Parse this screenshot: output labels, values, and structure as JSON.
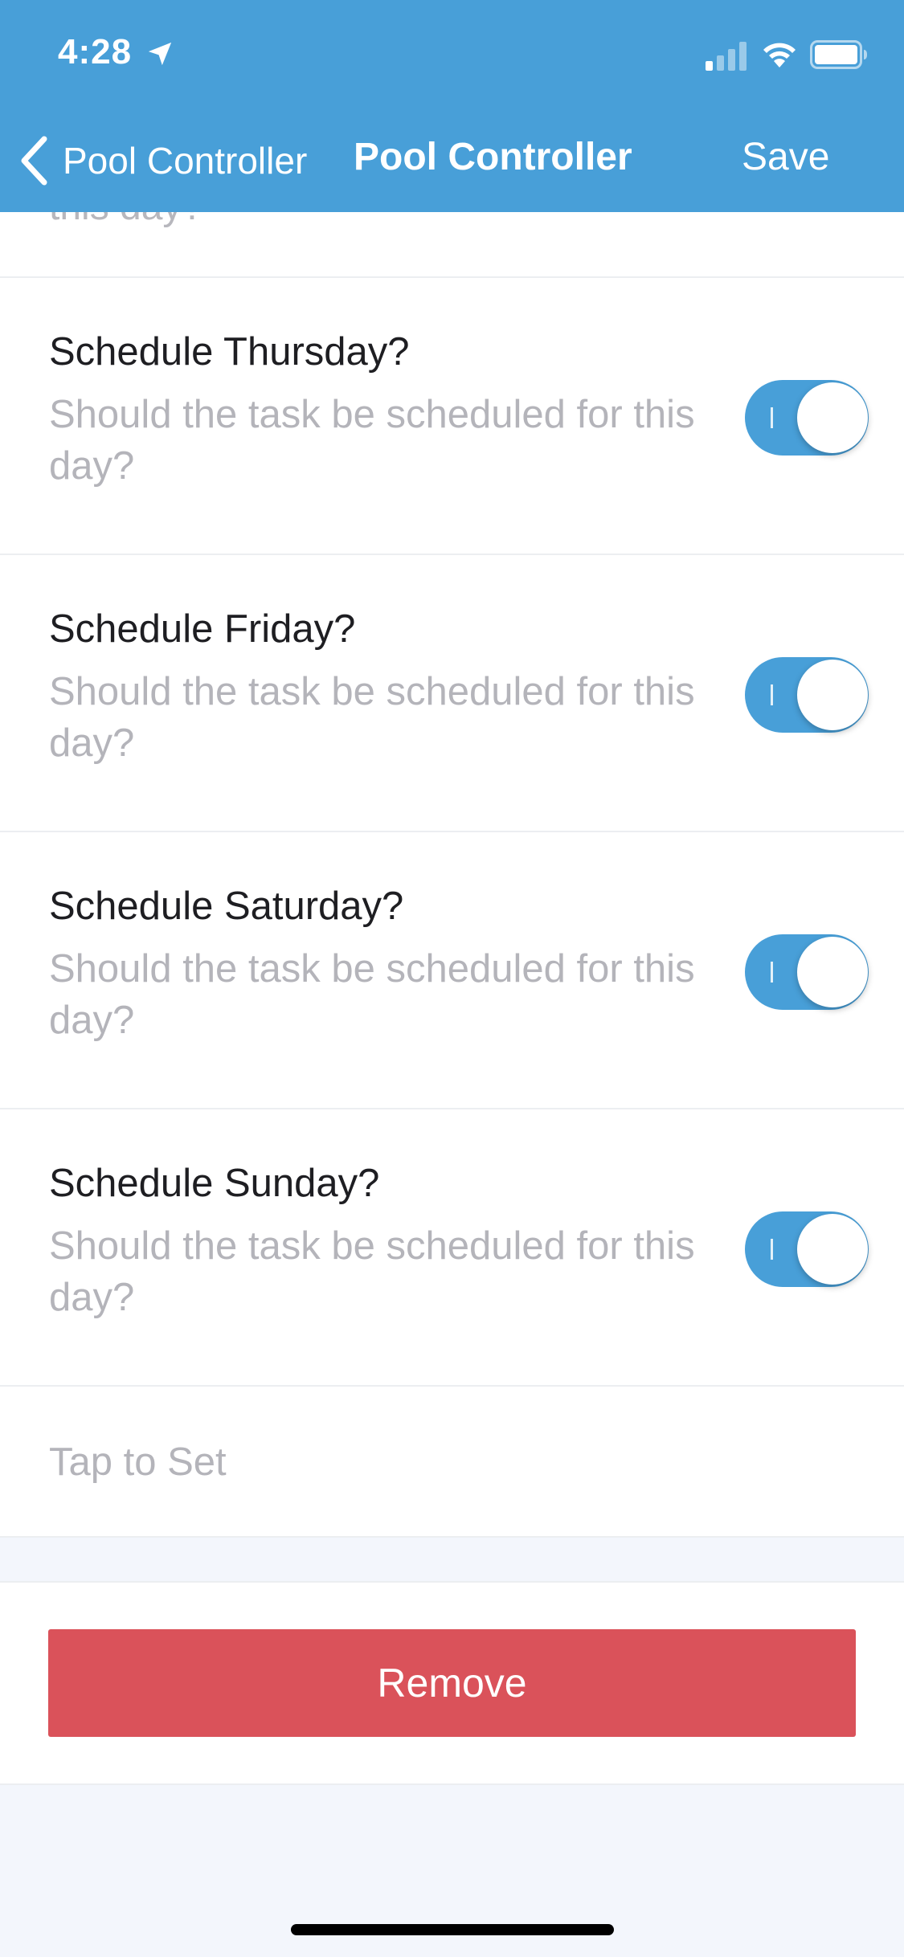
{
  "status_bar": {
    "time": "4:28"
  },
  "nav": {
    "back_label": "Pool Controller",
    "title": "Pool Controller",
    "save_label": "Save"
  },
  "list": {
    "cut_off_text": "this day?",
    "rows": [
      {
        "title": "Schedule Thursday?",
        "subtitle": "Should the task be scheduled for this day?",
        "enabled": true
      },
      {
        "title": "Schedule Friday?",
        "subtitle": "Should the task be scheduled for this day?",
        "enabled": true
      },
      {
        "title": "Schedule Saturday?",
        "subtitle": "Should the task be scheduled for this day?",
        "enabled": true
      },
      {
        "title": "Schedule Sunday?",
        "subtitle": "Should the task be scheduled for this day?",
        "enabled": true
      }
    ],
    "tap_to_set": "Tap to Set"
  },
  "actions": {
    "remove_label": "Remove"
  },
  "colors": {
    "accent": "#489fd8",
    "danger": "#da525a",
    "background": "#f3f6fc"
  }
}
